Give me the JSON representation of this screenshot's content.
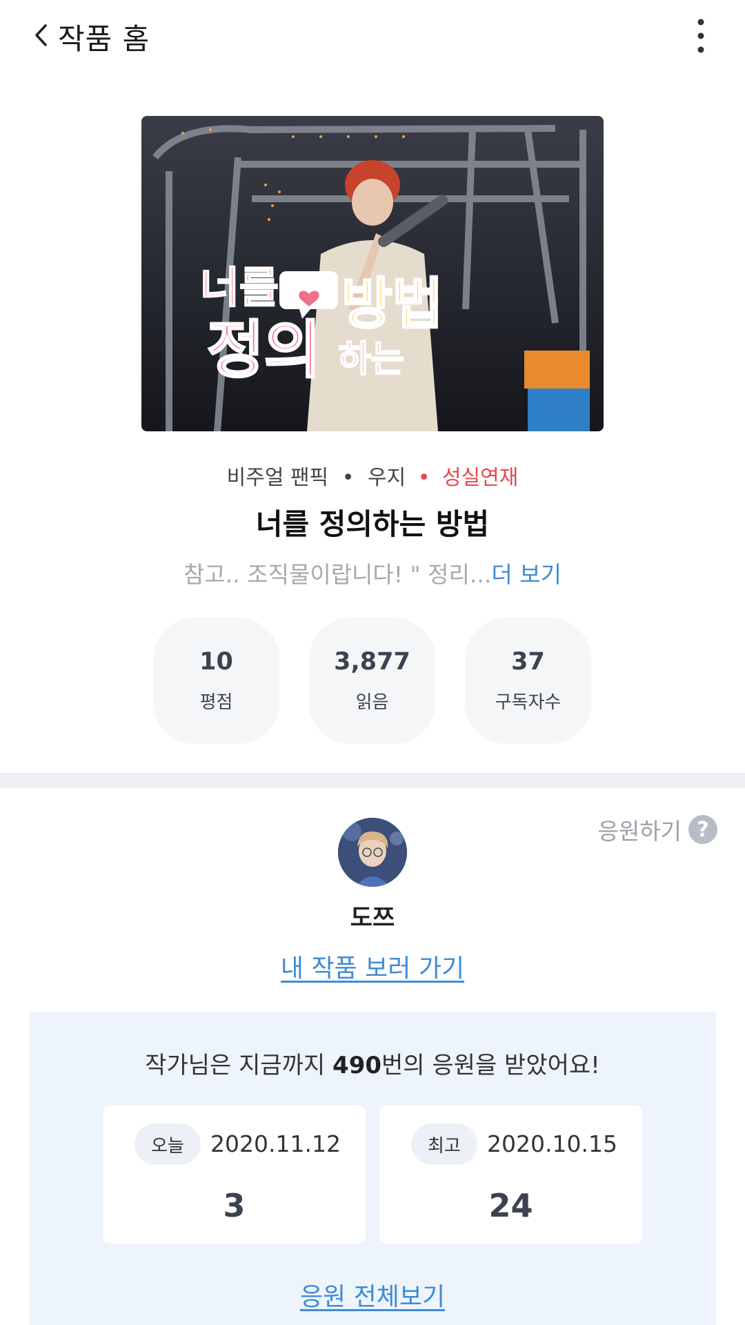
{
  "header": {
    "title": "작품 홈",
    "back_icon": "chevron-left-icon",
    "more_icon": "more-vertical-icon"
  },
  "cover": {
    "title_art_lines": [
      "너를",
      "정의",
      "방법",
      "하는"
    ],
    "description": "Cover image: performer with red hair holding a microphone, pink and yellow stylized title lettering"
  },
  "work": {
    "category": "비주얼 팬픽",
    "separator": "•",
    "tag": "우지",
    "status": "성실연재",
    "title": "너를 정의하는 방법",
    "description": "참고.. 조직물이랍니다!   \" 정리...",
    "more_label": "더 보기"
  },
  "stats": [
    {
      "value": "10",
      "label": "평점"
    },
    {
      "value": "3,877",
      "label": "읽음"
    },
    {
      "value": "37",
      "label": "구독자수"
    }
  ],
  "author": {
    "name": "도쯔",
    "works_link": "내 작품 보러 가기",
    "cheer_label": "응원하기",
    "help_symbol": "?"
  },
  "cheer": {
    "summary_prefix": "작가님은 지금까지 ",
    "summary_count": "490",
    "summary_suffix": "번의 응원을 받았어요!",
    "today": {
      "tag": "오늘",
      "date": "2020.11.12",
      "count": "3"
    },
    "best": {
      "tag": "최고",
      "date": "2020.10.15",
      "count": "24"
    },
    "all_link": "응원 전체보기"
  },
  "colors": {
    "accent_link": "#3f8bd4",
    "status_red": "#e5484d",
    "panel_bg": "#eef4fb",
    "stat_bg": "#f5f6f8"
  }
}
